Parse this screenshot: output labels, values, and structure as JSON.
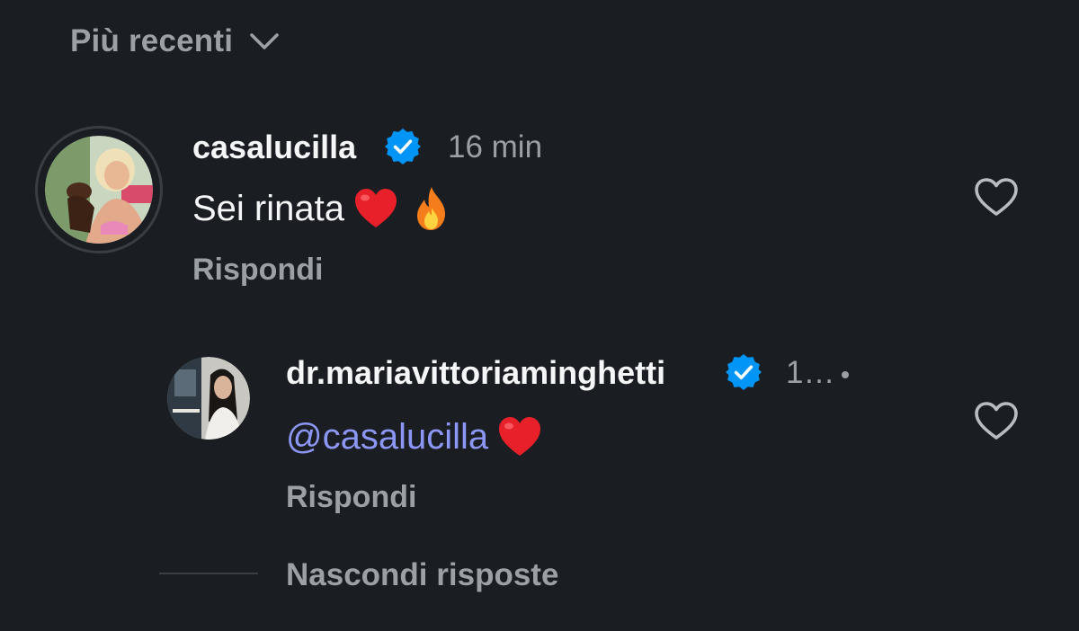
{
  "sort": {
    "label": "Più recenti",
    "icon": "chevron-down-icon"
  },
  "comments": [
    {
      "username": "casalucilla",
      "verified": true,
      "time": "16 min",
      "text": "Sei rinata",
      "emojis": [
        "red-heart",
        "fire"
      ],
      "reply_label": "Rispondi"
    }
  ],
  "reply": {
    "username": "dr.mariavittoriaminghetti",
    "verified": true,
    "time": "1…",
    "mention": "@casalucilla",
    "emojis": [
      "red-heart"
    ],
    "reply_label": "Rispondi"
  },
  "hide_replies_label": "Nascondi risposte",
  "colors": {
    "background": "#1a1d21",
    "muted_text": "#9aa0a6",
    "verified_blue": "#0095f6",
    "mention": "#8b96f5",
    "heart_red": "#e8202a"
  }
}
